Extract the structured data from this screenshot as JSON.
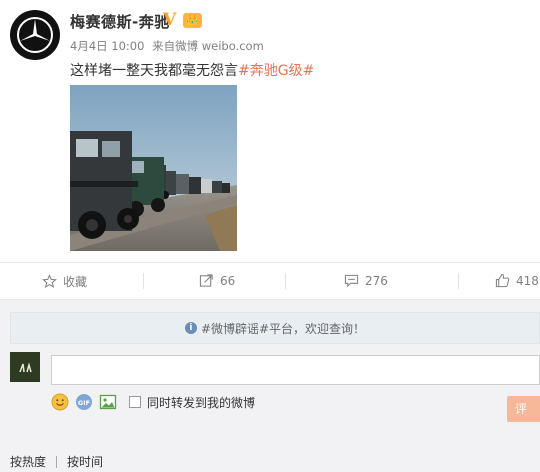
{
  "post": {
    "author": "梅赛德斯-奔驰",
    "verified_mark": "V",
    "member_badge": "👑",
    "date": "4月4日 10:00",
    "source_prefix": "来自",
    "source": "微博 weibo.com",
    "text": "这样堵一整天我都毫无怨言",
    "hashtag": "#奔驰G级#"
  },
  "actions": {
    "favorite_label": "收藏",
    "forward_count": "66",
    "comment_count": "276",
    "like_count": "418"
  },
  "comments": {
    "notice_icon": "i",
    "notice": "#微博辟谣#平台，欢迎查询！",
    "input_value": "",
    "forward_label": "同时转发到我的微博",
    "submit_label": "评",
    "sort_hot": "按热度",
    "sort_time": "按时间"
  }
}
